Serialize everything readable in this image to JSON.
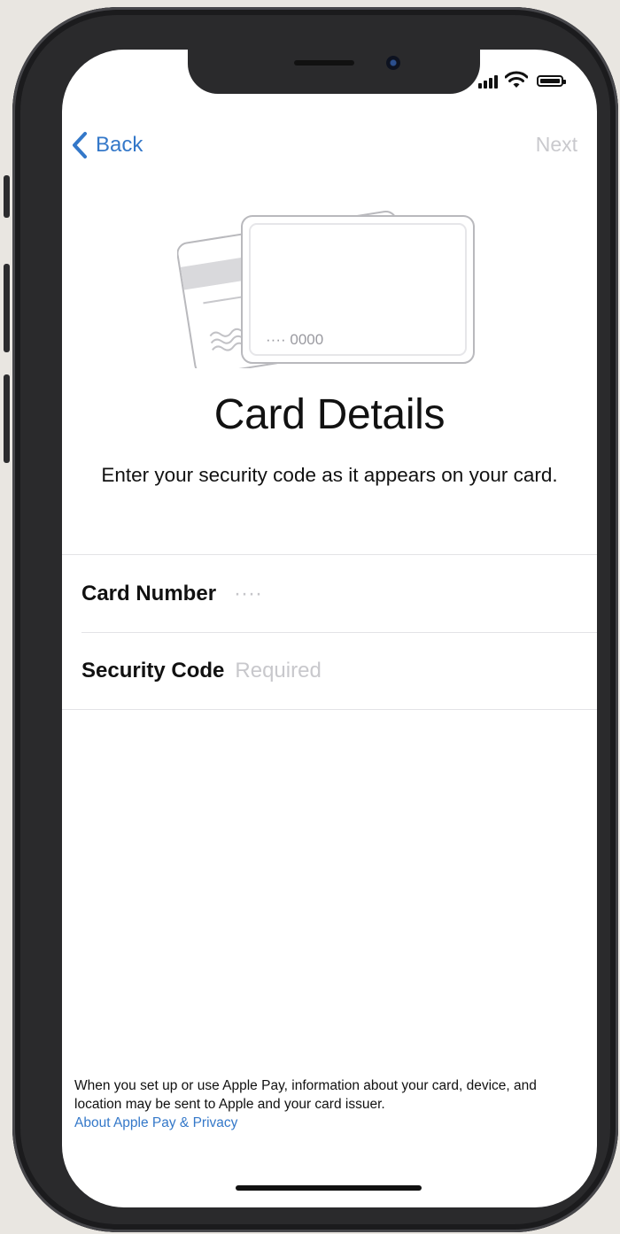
{
  "status_bar": {
    "icons": [
      "cellular-signal-icon",
      "wifi-icon",
      "battery-icon"
    ]
  },
  "nav": {
    "back_label": "Back",
    "next_label": "Next"
  },
  "card_illustration": {
    "masked_number": "···· 0000"
  },
  "page": {
    "title": "Card Details",
    "subtitle": "Enter your security code as it appears on your card."
  },
  "form": {
    "card_number": {
      "label": "Card Number",
      "value": "····"
    },
    "security_code": {
      "label": "Security Code",
      "placeholder": "Required",
      "value": ""
    }
  },
  "footer": {
    "text": "When you set up or use Apple Pay, information about your card, device, and location may be sent to Apple and your card issuer.",
    "link_label": "About Apple Pay & Privacy"
  },
  "colors": {
    "accent": "#3478c9",
    "disabled": "#c9c9cd",
    "text": "#111111",
    "background": "#ffffff",
    "device": "#2a2a2c"
  }
}
